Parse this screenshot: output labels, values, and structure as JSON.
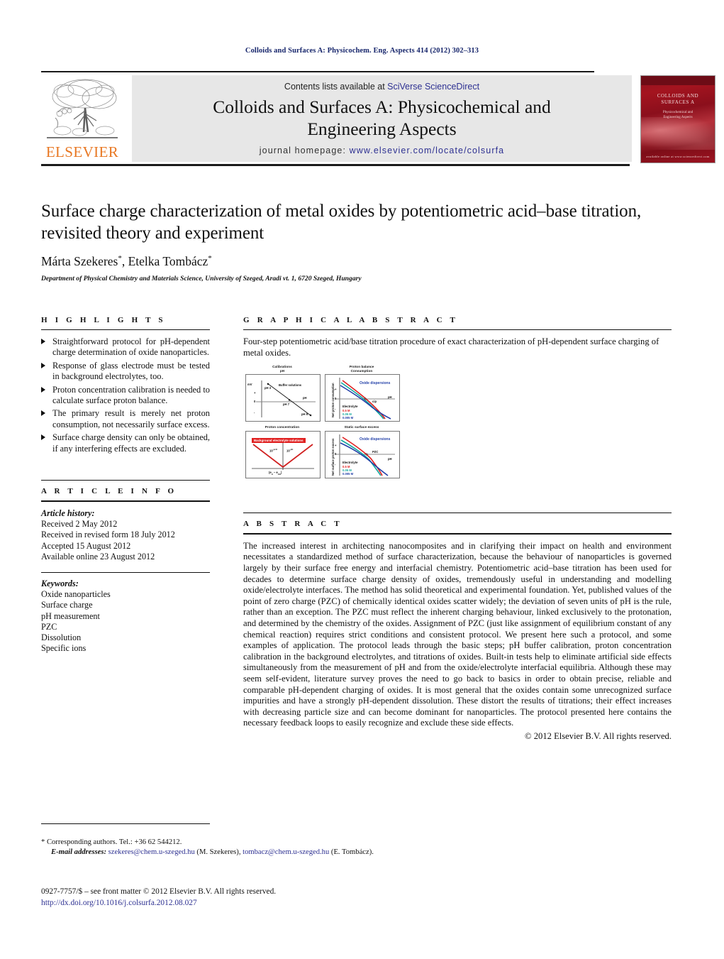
{
  "running_head": "Colloids and Surfaces A: Physicochem. Eng. Aspects 414 (2012) 302–313",
  "masthead": {
    "contents_prefix": "Contents lists available at ",
    "sciencedirect": "SciVerse ScienceDirect",
    "journal_title_line1": "Colloids and Surfaces A: Physicochemical and",
    "journal_title_line2": "Engineering Aspects",
    "homepage_prefix": "journal homepage: ",
    "homepage_url": "www.elsevier.com/locate/colsurfa",
    "publisher_name": "ELSEVIER",
    "cover": {
      "top_line": "COLLOIDS AND",
      "top_line2": "SURFACES A",
      "subtitle": "Physicochemical and\nEngineering Aspects",
      "bottom_line": "available online at www.sciencedirect.com"
    }
  },
  "article": {
    "title": "Surface charge characterization of metal oxides by potentiometric acid–base titration, revisited theory and experiment",
    "authors": "Márta Szekeres, Etelka Tombácz",
    "author_marks": "*",
    "affiliation": "Department of Physical Chemistry and Materials Science, University of Szeged, Aradi vt. 1, 6720 Szeged, Hungary"
  },
  "highlights": {
    "heading": "HIGHLIGHTS",
    "items": [
      "Straightforward protocol for pH-dependent charge determination of oxide nanoparticles.",
      "Response of glass electrode must be tested in background electrolytes, too.",
      "Proton concentration calibration is needed to calculate surface proton balance.",
      "The primary result is merely net proton consumption, not necessarily surface excess.",
      "Surface charge density can only be obtained, if any interfering effects are excluded."
    ]
  },
  "graphical_abstract": {
    "heading": "GRAPHICAL ABSTRACT",
    "caption": "Four-step potentiometric acid/base titration procedure of exact characterization of pH-dependent surface charging of metal oxides.",
    "panels": [
      {
        "title": "Calibrations\npH",
        "title_line1": "Calibrations",
        "title_line2": "pH",
        "y_axis": "mV",
        "x_axis": "pH",
        "series_label": "Buffer solutions",
        "annotations": [
          "pH 3",
          "pH 7",
          "pH 9"
        ],
        "axis_ticks": [
          "+",
          "0",
          "-"
        ]
      },
      {
        "title_line1": "Proton balance",
        "title_line2": "Consumption",
        "y_axis": "Net proton consumption",
        "x_axis": "pH",
        "series_label": "Oxide dispersions",
        "annotations": [
          "cip"
        ],
        "axis_ticks": [
          "+",
          "0",
          "-"
        ],
        "legend_title": "Electrolyte",
        "legend": [
          "0.5 M",
          "0.05 M",
          "0.005 M"
        ]
      },
      {
        "title_line1": "Proton concentration",
        "series_label": "Background electrolyte solutions",
        "annotations": [
          "10",
          "10",
          "(e",
          " - e",
          ")"
        ],
        "exp_left": "-pcH",
        "exp_right": "-pH",
        "x_axis": "(e_H - e_OH)"
      },
      {
        "title_line1": "Static surface excess",
        "y_axis": "Net surface proton excess",
        "x_axis": "pH",
        "series_label": "Oxide dispersions",
        "annotations": [
          "PZC"
        ],
        "axis_ticks": [
          "+",
          "0",
          "-"
        ],
        "legend_title": "Electrolyte",
        "legend": [
          "0.5 M",
          "0.05 M",
          "0.005 M"
        ]
      }
    ]
  },
  "article_info": {
    "heading": "ARTICLE INFO",
    "history_label": "Article history:",
    "history": [
      "Received 2 May 2012",
      "Received in revised form 18 July 2012",
      "Accepted 15 August 2012",
      "Available online 23 August 2012"
    ],
    "keywords_label": "Keywords:",
    "keywords": [
      "Oxide nanoparticles",
      "Surface charge",
      "pH measurement",
      "PZC",
      "Dissolution",
      "Specific ions"
    ]
  },
  "abstract": {
    "heading": "ABSTRACT",
    "text": "The increased interest in architecting nanocomposites and in clarifying their impact on health and environment necessitates a standardized method of surface characterization, because the behaviour of nanoparticles is governed largely by their surface free energy and interfacial chemistry. Potentiometric acid–base titration has been used for decades to determine surface charge density of oxides, tremendously useful in understanding and modelling oxide/electrolyte interfaces. The method has solid theoretical and experimental foundation. Yet, published values of the point of zero charge (PZC) of chemically identical oxides scatter widely; the deviation of seven units of pH is the rule, rather than an exception. The PZC must reflect the inherent charging behaviour, linked exclusively to the protonation, and determined by the chemistry of the oxides. Assignment of PZC (just like assignment of equilibrium constant of any chemical reaction) requires strict conditions and consistent protocol. We present here such a protocol, and some examples of application. The protocol leads through the basic steps; pH buffer calibration, proton concentration calibration in the background electrolytes, and titrations of oxides. Built-in tests help to eliminate artificial side effects simultaneously from the measurement of pH and from the oxide/electrolyte interfacial equilibria. Although these may seem self-evident, literature survey proves the need to go back to basics in order to obtain precise, reliable and comparable pH-dependent charging of oxides. It is most general that the oxides contain some unrecognized surface impurities and have a strongly pH-dependent dissolution. These distort the results of titrations; their effect increases with decreasing particle size and can become dominant for nanoparticles. The protocol presented here contains the necessary feedback loops to easily recognize and exclude these side effects.",
    "copyright": "© 2012 Elsevier B.V. All rights reserved."
  },
  "footer": {
    "corresponding": "* Corresponding authors. Tel.: +36 62 544212.",
    "email_label": "E-mail addresses:",
    "email1": "szekeres@chem.u-szeged.hu",
    "email1_who": " (M. Szekeres),",
    "email2": "tombacz@chem.u-szeged.hu",
    "email2_who": " (E. Tombácz).",
    "issn_line": "0927-7757/$ – see front matter © 2012 Elsevier B.V. All rights reserved.",
    "doi": "http://dx.doi.org/10.1016/j.colsurfa.2012.08.027"
  },
  "colors": {
    "running_head": "#16256b",
    "link": "#2e3192",
    "elsevier_orange": "#e87722",
    "band_grey": "#e7e7e7",
    "cover_red": "#9c1320",
    "series_red": "#e02020",
    "series_teal": "#13a89e",
    "series_blue": "#2340a8"
  }
}
